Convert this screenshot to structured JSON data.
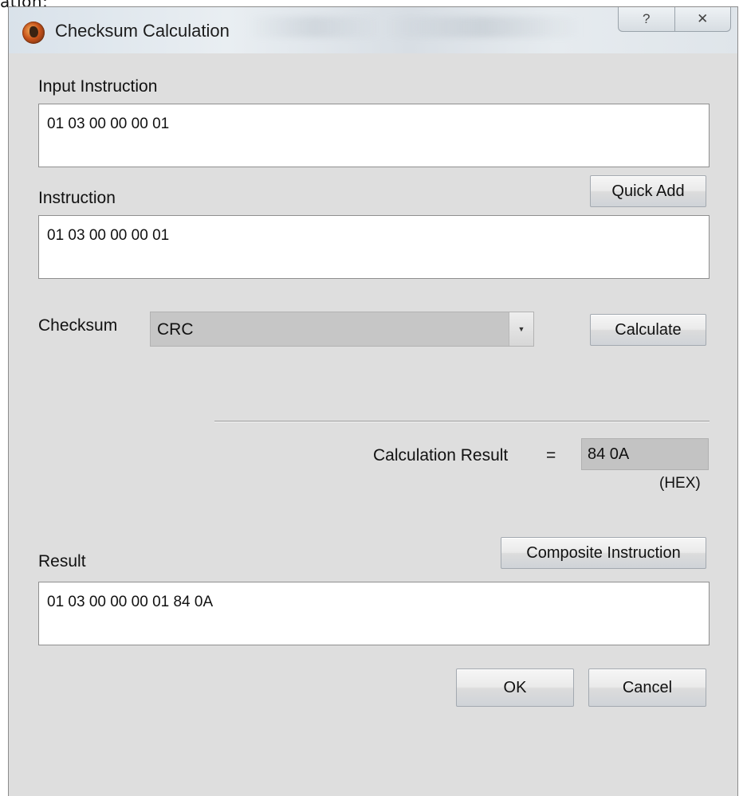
{
  "fragment_text": "ation:",
  "window": {
    "title": "Checksum Calculation",
    "help_label": "?",
    "close_label": "✕"
  },
  "input_instruction": {
    "label": "Input Instruction",
    "value": "01 03 00 00 00 01"
  },
  "instruction": {
    "label": "Instruction",
    "value": "01 03 00 00 00 01",
    "quick_add_label": "Quick Add"
  },
  "checksum": {
    "label": "Checksum",
    "selected": "CRC",
    "calculate_label": "Calculate"
  },
  "calculation": {
    "label": "Calculation Result",
    "equals": "=",
    "value": "84 0A",
    "unit": "(HEX)"
  },
  "result": {
    "label": "Result",
    "composite_label": "Composite Instruction",
    "value": "01 03 00 00 00 01 84 0A"
  },
  "footer": {
    "ok_label": "OK",
    "cancel_label": "Cancel"
  },
  "icons": {
    "app": "app-logo-icon",
    "help": "help-icon",
    "close": "close-icon",
    "dropdown": "chevron-down-icon"
  }
}
